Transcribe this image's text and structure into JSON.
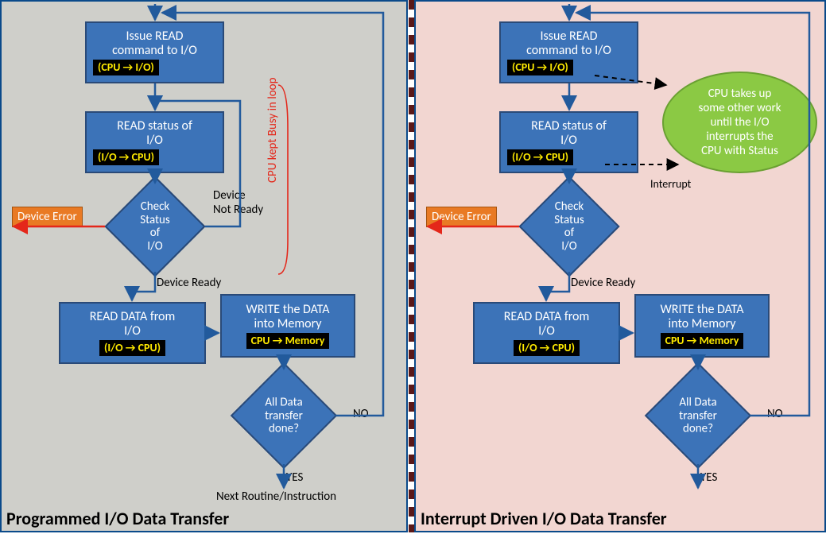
{
  "left": {
    "title": "Programmed I/O Data Transfer",
    "issue": {
      "text": "Issue READ\ncommand to I/O",
      "tag": "(CPU → I/O)"
    },
    "status": {
      "text": "READ status of\nI/O",
      "tag": "(I/O → CPU)"
    },
    "check": "Check\nStatus of\nI/O",
    "readdata": {
      "text": "READ DATA from\nI/O",
      "tag": "(I/O → CPU)"
    },
    "write": {
      "text": "WRITE the DATA\ninto Memory",
      "tag": "CPU → Memory"
    },
    "done": "All  Data\ntransfer\ndone?",
    "labels": {
      "device_error": "Device Error",
      "device_not_ready": "Device\nNot Ready",
      "device_ready": "Device Ready",
      "no": "NO",
      "yes": "YES",
      "next": "Next Routine/Instruction",
      "busy": "CPU kept Busy in loop"
    }
  },
  "right": {
    "title": "Interrupt Driven I/O Data Transfer",
    "issue": {
      "text": "Issue READ\ncommand to I/O",
      "tag": "(CPU → I/O)"
    },
    "status": {
      "text": "READ status of\nI/O",
      "tag": "(I/O → CPU)"
    },
    "check": "Check\nStatus of\nI/O",
    "readdata": {
      "text": "READ DATA from\nI/O",
      "tag": "(I/O → CPU)"
    },
    "write": {
      "text": "WRITE the DATA\ninto Memory",
      "tag": "CPU → Memory"
    },
    "done": "All  Data\ntransfer\ndone?",
    "ellipse": "CPU takes up\nsome other work\nuntil the I/O\ninterrupts the\nCPU with Status",
    "labels": {
      "device_error": "Device Error",
      "device_ready": "Device Ready",
      "no": "NO",
      "yes": "YES",
      "interrupt": "Interrupt"
    }
  }
}
